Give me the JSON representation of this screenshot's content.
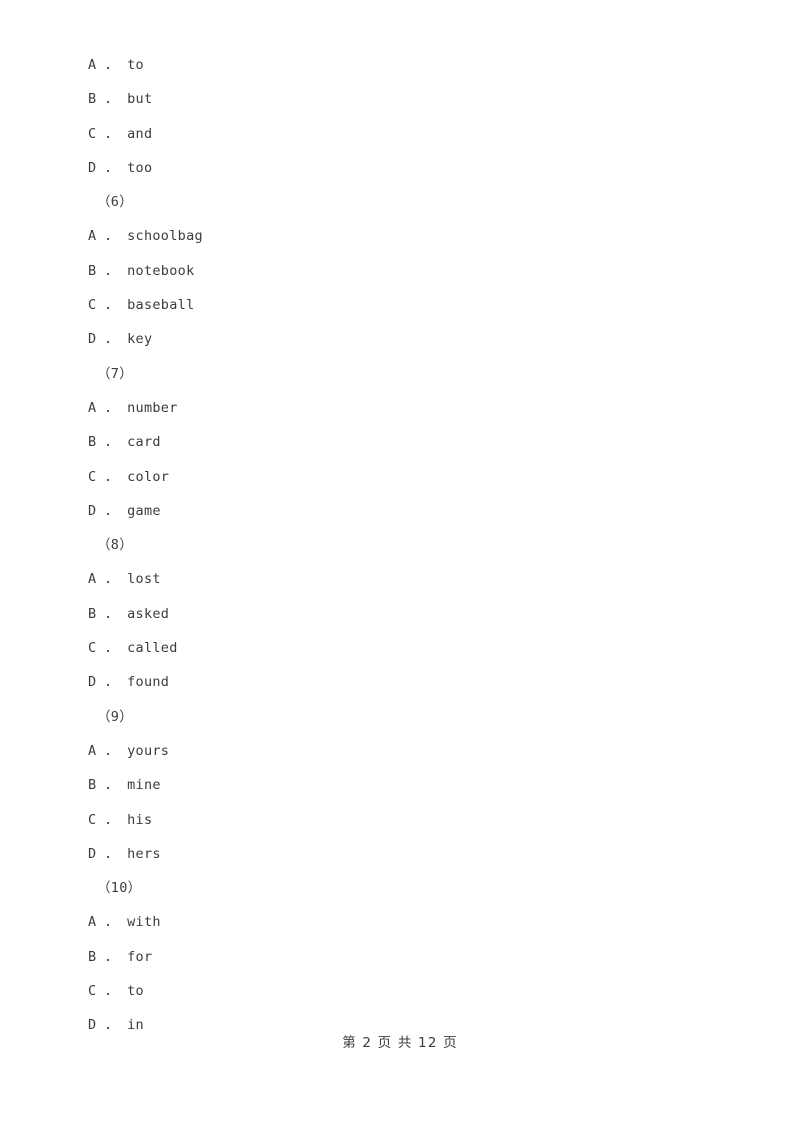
{
  "document": {
    "background_color": "#ffffff",
    "text_color": "#3c3c3c"
  },
  "body": {
    "blocks": [
      {
        "type": "options",
        "items": [
          {
            "letter": "A",
            "sep": " ． ",
            "text": "to"
          },
          {
            "letter": "B",
            "sep": " ． ",
            "text": "but"
          },
          {
            "letter": "C",
            "sep": " ． ",
            "text": "and"
          },
          {
            "letter": "D",
            "sep": " ． ",
            "text": "too"
          }
        ]
      },
      {
        "type": "question_number",
        "label": "（6）"
      },
      {
        "type": "options",
        "items": [
          {
            "letter": "A",
            "sep": " ． ",
            "text": "schoolbag"
          },
          {
            "letter": "B",
            "sep": " ． ",
            "text": "notebook"
          },
          {
            "letter": "C",
            "sep": " ． ",
            "text": "baseball"
          },
          {
            "letter": "D",
            "sep": " ． ",
            "text": "key"
          }
        ]
      },
      {
        "type": "question_number",
        "label": "（7）"
      },
      {
        "type": "options",
        "items": [
          {
            "letter": "A",
            "sep": " ． ",
            "text": "number"
          },
          {
            "letter": "B",
            "sep": " ． ",
            "text": "card"
          },
          {
            "letter": "C",
            "sep": " ． ",
            "text": "color"
          },
          {
            "letter": "D",
            "sep": " ． ",
            "text": "game"
          }
        ]
      },
      {
        "type": "question_number",
        "label": "（8）"
      },
      {
        "type": "options",
        "items": [
          {
            "letter": "A",
            "sep": " ． ",
            "text": "lost"
          },
          {
            "letter": "B",
            "sep": " ． ",
            "text": "asked"
          },
          {
            "letter": "C",
            "sep": " ． ",
            "text": "called"
          },
          {
            "letter": "D",
            "sep": " ． ",
            "text": "found"
          }
        ]
      },
      {
        "type": "question_number",
        "label": "（9）"
      },
      {
        "type": "options",
        "items": [
          {
            "letter": "A",
            "sep": " ． ",
            "text": "yours"
          },
          {
            "letter": "B",
            "sep": " ． ",
            "text": "mine"
          },
          {
            "letter": "C",
            "sep": " ． ",
            "text": "his"
          },
          {
            "letter": "D",
            "sep": " ． ",
            "text": "hers"
          }
        ]
      },
      {
        "type": "question_number",
        "label": "（10）"
      },
      {
        "type": "options",
        "items": [
          {
            "letter": "A",
            "sep": " ． ",
            "text": "with"
          },
          {
            "letter": "B",
            "sep": " ． ",
            "text": "for"
          },
          {
            "letter": "C",
            "sep": " ． ",
            "text": "to"
          },
          {
            "letter": "D",
            "sep": " ． ",
            "text": "in"
          }
        ]
      }
    ]
  },
  "footer": {
    "text": "第 2 页 共 12 页",
    "current_page": "2",
    "total_pages": "12"
  }
}
